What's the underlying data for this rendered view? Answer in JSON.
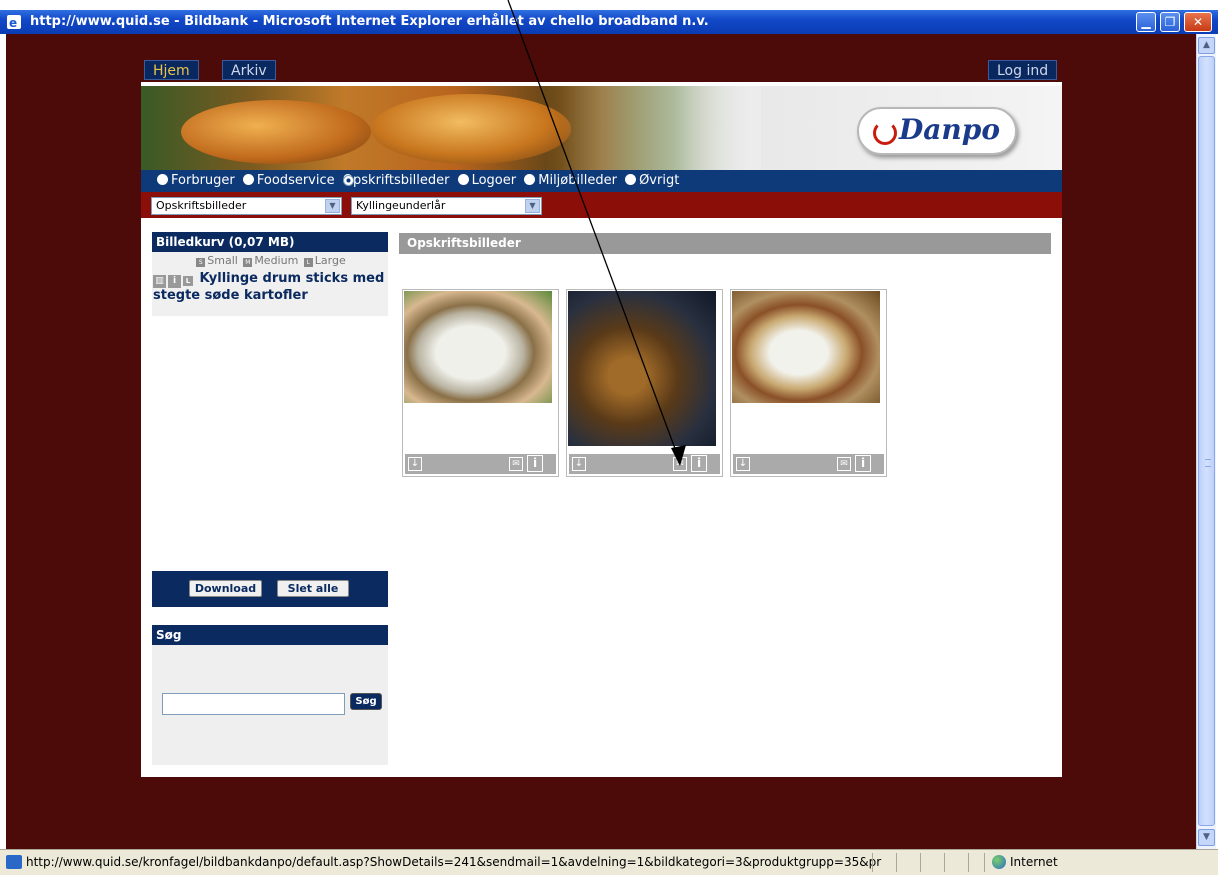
{
  "window": {
    "title": "http://www.quid.se - Bildbank - Microsoft Internet Explorer erhållet av chello broadband n.v."
  },
  "nav": {
    "hjem": "Hjem",
    "arkiv": "Arkiv",
    "login": "Log ind"
  },
  "brand": {
    "logo": "Danpo"
  },
  "categories": [
    "Forbruger",
    "Foodservice",
    "Opskriftsbilleder",
    "Logoer",
    "Miljøbilleder",
    "Øvrigt"
  ],
  "selected_category": "Opskriftsbilleder",
  "filters": {
    "category": "Opskriftsbilleder",
    "product": "Kyllingeunderlår"
  },
  "basket": {
    "title": "Billedkurv (0,07 MB)",
    "sizes": {
      "small": "Small",
      "medium": "Medium",
      "large": "Large"
    },
    "item": "Kyllinge drum sticks med stegte søde kartofler",
    "download": "Download",
    "delete_all": "Slet alle"
  },
  "search": {
    "title": "Søg",
    "button": "Søg",
    "value": ""
  },
  "main": {
    "title": "Opskriftsbilleder"
  },
  "thumbnails": [
    {
      "name": "thumb-1"
    },
    {
      "name": "thumb-2"
    },
    {
      "name": "thumb-3"
    }
  ],
  "status": {
    "url": "http://www.quid.se/kronfagel/bildbankdanpo/default.asp?ShowDetails=241&sendmail=1&avdelning=1&bildkategori=3&produktgrupp=35&pr",
    "zone": "Internet"
  }
}
